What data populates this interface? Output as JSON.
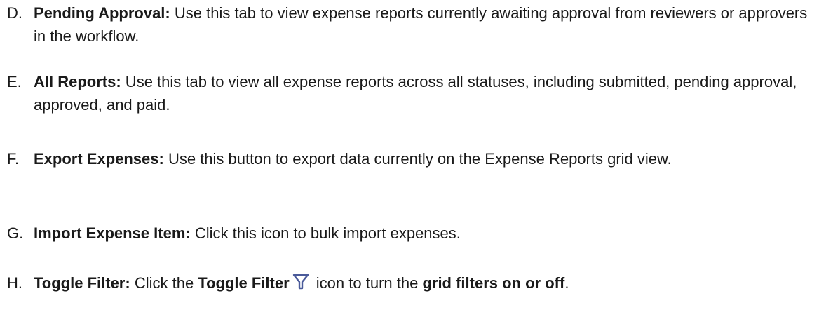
{
  "items": [
    {
      "marker": "D.",
      "term": "Pending Approval:",
      "text": " Use this tab to view expense reports currently awaiting approval from reviewers or approvers in the workflow."
    },
    {
      "marker": "E.",
      "term": "All Reports:",
      "text": " Use this tab to view all expense reports across all statuses, including submitted, pending approval, approved, and paid."
    },
    {
      "marker": "F.",
      "term": "Export Expenses:",
      "text": " Use this button to export data currently on the Expense Reports grid view."
    },
    {
      "marker": "G.",
      "term": "Import Expense Item:",
      "text": " Click this icon to bulk import expenses."
    },
    {
      "marker": "H.",
      "term": "Toggle Filter:",
      "text_a": " Click the ",
      "bold_a": "Toggle Filter",
      "text_b": " icon to turn the ",
      "bold_b": "grid filters on or off",
      "text_c": "."
    }
  ],
  "icons": {
    "filter": "filter-icon",
    "filter_color": "#4a5a9a"
  }
}
